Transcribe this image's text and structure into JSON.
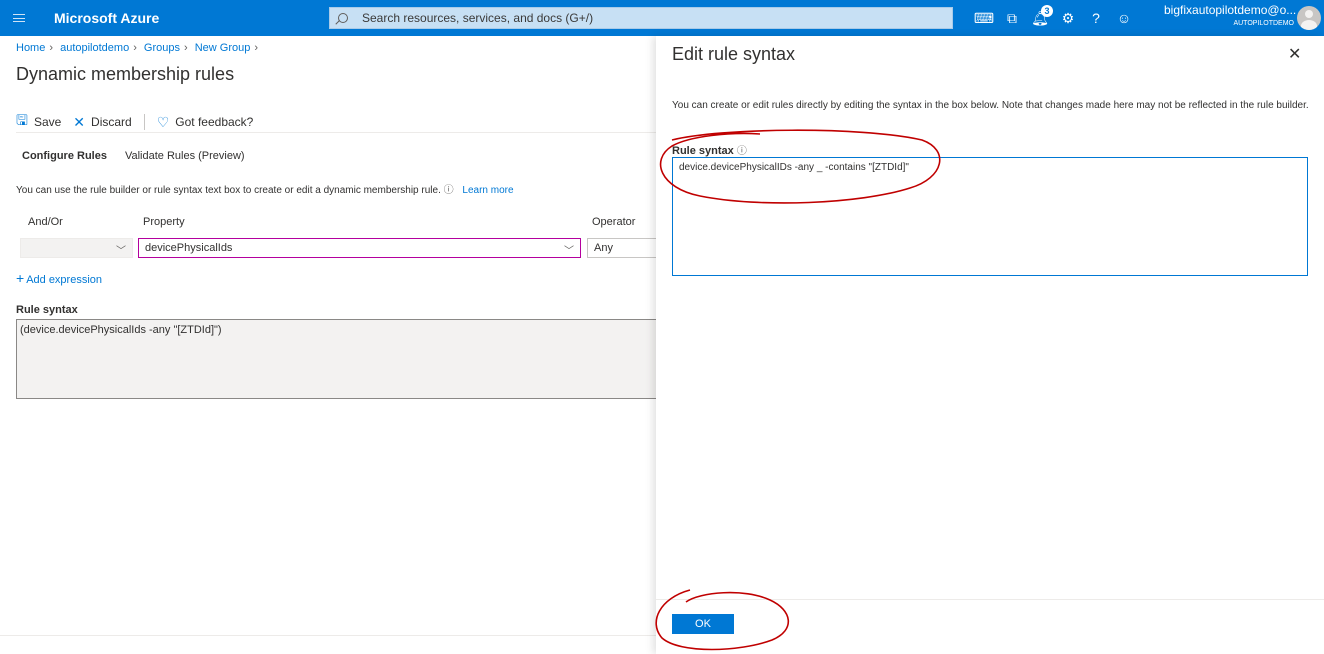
{
  "topbar": {
    "brand": "Microsoft Azure",
    "search_placeholder": "Search resources, services, and docs (G+/)",
    "notification_count": "3",
    "account_email": "bigfixautopilotdemo@o...",
    "account_tenant": "AUTOPILOTDEMO",
    "icons": [
      "cloud-shell-icon",
      "directory-filter-icon",
      "notifications-icon",
      "settings-icon",
      "help-icon",
      "feedback-icon"
    ]
  },
  "breadcrumb": [
    "Home",
    "autopilotdemo",
    "Groups",
    "New Group"
  ],
  "page": {
    "title": "Dynamic membership rules",
    "commands": {
      "save": "Save",
      "discard": "Discard",
      "feedback": "Got feedback?"
    },
    "tabs": [
      "Configure Rules",
      "Validate Rules (Preview)"
    ],
    "help_text": "You can use the rule builder or rule syntax text box to create or edit a dynamic membership rule.",
    "learn_more": "Learn more",
    "columns": {
      "and_or": "And/Or",
      "property": "Property",
      "operator": "Operator"
    },
    "row": {
      "and_or": "",
      "property": "devicePhysicalIds",
      "operator": "Any"
    },
    "add_expression": "Add expression",
    "rule_syntax_label": "Rule syntax",
    "rule_syntax_value": "(device.devicePhysicalIds -any \"[ZTDId]\")"
  },
  "panel": {
    "title": "Edit rule syntax",
    "description": "You can create or edit rules directly by editing the syntax in the box below. Note that changes made here may not be reflected in the rule builder.",
    "label": "Rule syntax",
    "value": "device.devicePhysicalIDs -any _ -contains \"[ZTDId]\"",
    "ok_label": "OK"
  },
  "colors": {
    "accent": "#0078d4",
    "annotation": "#c00000"
  }
}
